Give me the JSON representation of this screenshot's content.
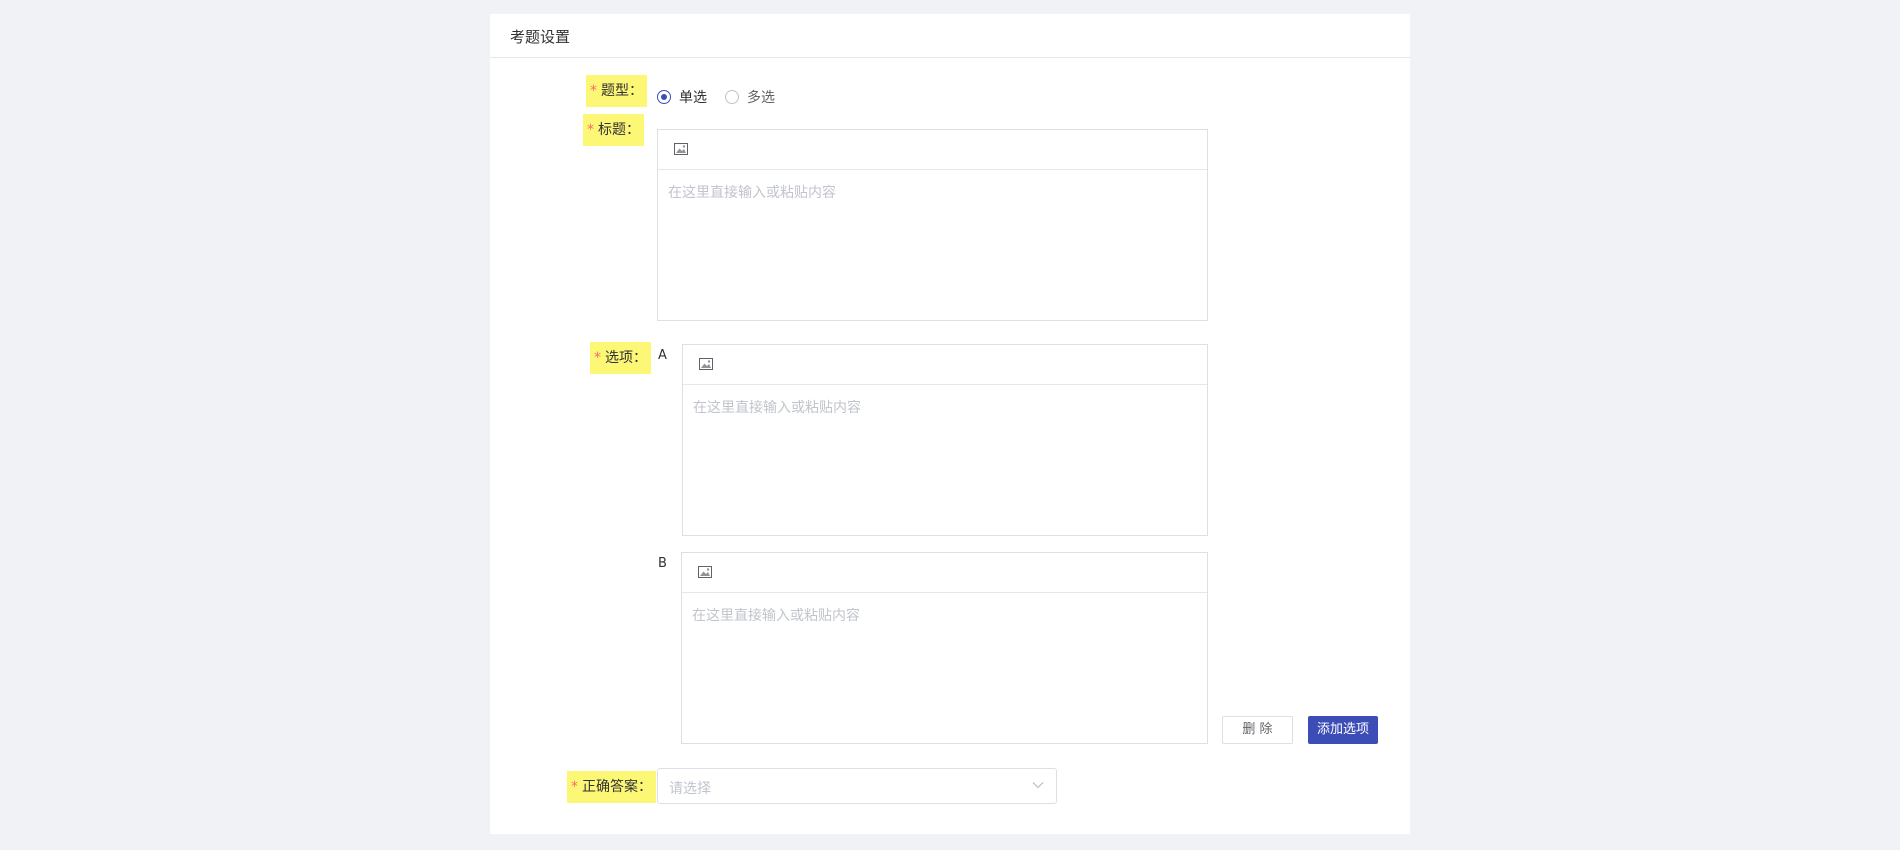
{
  "panel": {
    "title": "考题设置"
  },
  "form": {
    "required_mark": "*",
    "type": {
      "label": "题型：",
      "options": [
        {
          "label": "单选",
          "checked": true
        },
        {
          "label": "多选",
          "checked": false
        }
      ]
    },
    "title_field": {
      "label": "标题：",
      "placeholder": "在这里直接输入或粘贴内容",
      "toolbar_icon": "image-icon"
    },
    "options_field": {
      "label": "选项：",
      "items": [
        {
          "letter": "A",
          "placeholder": "在这里直接输入或粘贴内容"
        },
        {
          "letter": "B",
          "placeholder": "在这里直接输入或粘贴内容"
        }
      ],
      "delete_label": "删 除",
      "add_label": "添加选项"
    },
    "answer_field": {
      "label": "正确答案：",
      "placeholder": "请选择"
    }
  },
  "colors": {
    "background": "#f0f2f5",
    "label_highlight": "#fdf776",
    "required": "#f56c6c",
    "primary": "#3d4db7"
  }
}
